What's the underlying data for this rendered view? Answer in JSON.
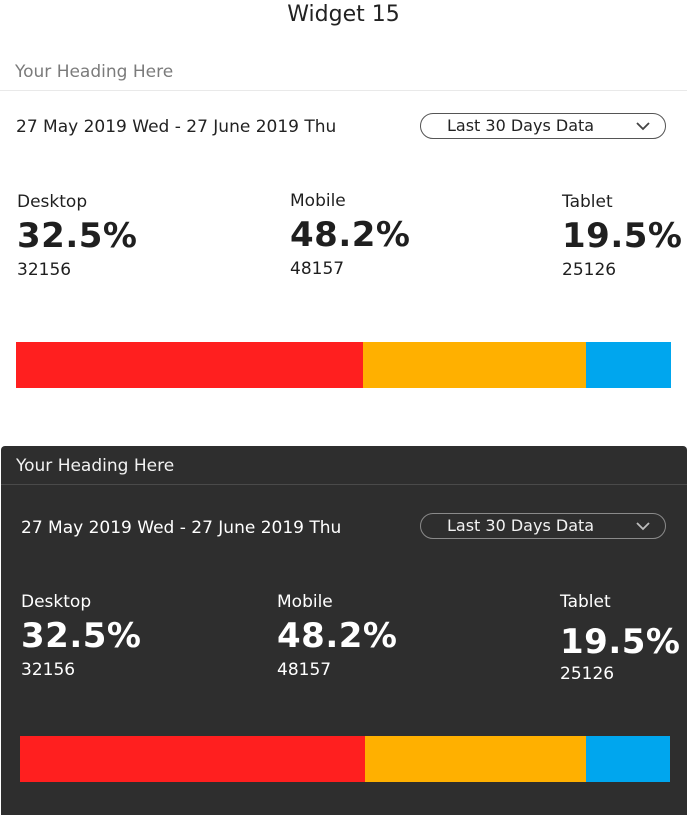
{
  "page": {
    "title": "Widget 15"
  },
  "widgets": [
    {
      "theme": "light",
      "heading": "Your Heading Here",
      "date_range": "27 May 2019 Wed - 27 June 2019 Thu",
      "select": {
        "label": "Last 30 Days Data",
        "icon": "chevron-down-icon"
      },
      "stats": [
        {
          "label": "Desktop",
          "percent": "32.5%",
          "count": "32156"
        },
        {
          "label": "Mobile",
          "percent": "48.2%",
          "count": "48157"
        },
        {
          "label": "Tablet",
          "percent": "19.5%",
          "count": "25126"
        }
      ]
    },
    {
      "theme": "dark",
      "heading": "Your Heading Here",
      "date_range": "27 May 2019 Wed - 27 June 2019 Thu",
      "select": {
        "label": "Last 30 Days Data",
        "icon": "chevron-down-icon"
      },
      "stats": [
        {
          "label": "Desktop",
          "percent": "32.5%",
          "count": "32156"
        },
        {
          "label": "Mobile",
          "percent": "48.2%",
          "count": "48157"
        },
        {
          "label": "Tablet",
          "percent": "19.5%",
          "count": "25126"
        }
      ]
    }
  ],
  "distribution": {
    "segments": [
      {
        "name": "Desktop",
        "value": 53,
        "color": "#ff1f1f"
      },
      {
        "name": "Mobile",
        "value": 34,
        "color": "#ffb000"
      },
      {
        "name": "Tablet",
        "value": 13,
        "color": "#00a6ee"
      }
    ]
  },
  "colors": {
    "light_bg": "#ffffff",
    "dark_bg": "#2e2e2e"
  }
}
